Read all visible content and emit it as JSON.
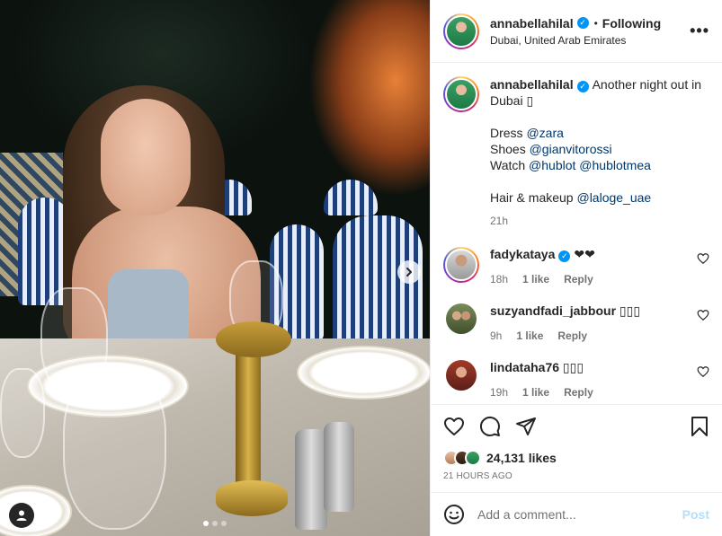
{
  "header": {
    "username": "annabellahilal",
    "separator": "•",
    "follow_state": "Following",
    "location": "Dubai, United Arab Emirates",
    "more_glyph": "•••"
  },
  "caption": {
    "username": "annabellahilal",
    "lines": [
      "Another night out in Dubai ▯",
      "",
      "Dress",
      "Shoes",
      "Watch",
      "",
      "Hair & makeup"
    ],
    "intro": "Another night out in Dubai ▯",
    "dress_label": "Dress",
    "dress_tag": "@zara",
    "shoes_label": "Shoes",
    "shoes_tag": "@gianvitorossi",
    "watch_label": "Watch",
    "watch_tag_1": "@hublot",
    "watch_tag_2": "@hublotmea",
    "hair_label": "Hair & makeup",
    "hair_tag": "@laloge_uae",
    "time": "21h"
  },
  "comments": [
    {
      "username": "fadykataya",
      "text": "❤❤",
      "time": "18h",
      "likes": "1 like",
      "reply": "Reply"
    },
    {
      "username": "suzyandfadi_jabbour",
      "text": "▯▯▯",
      "time": "9h",
      "likes": "1 like",
      "reply": "Reply"
    },
    {
      "username": "lindataha76",
      "text": "▯▯▯",
      "time": "19h",
      "likes": "1 like",
      "reply": "Reply"
    }
  ],
  "engagement": {
    "likes": "24,131 likes",
    "posted": "21 HOURS AGO"
  },
  "composer": {
    "placeholder": "Add a comment...",
    "post_label": "Post"
  },
  "icons": {
    "like": "heart-icon",
    "comment": "comment-icon",
    "share": "share-icon",
    "save": "bookmark-icon",
    "emoji": "emoji-icon",
    "next": "chevron-right-icon",
    "tag": "user-tag-icon"
  },
  "carousel": {
    "slides": 3,
    "active": 1
  },
  "colors": {
    "accent": "#0095f6",
    "link": "#00376b",
    "muted": "#737373",
    "post_disabled": "#b2dffc"
  }
}
